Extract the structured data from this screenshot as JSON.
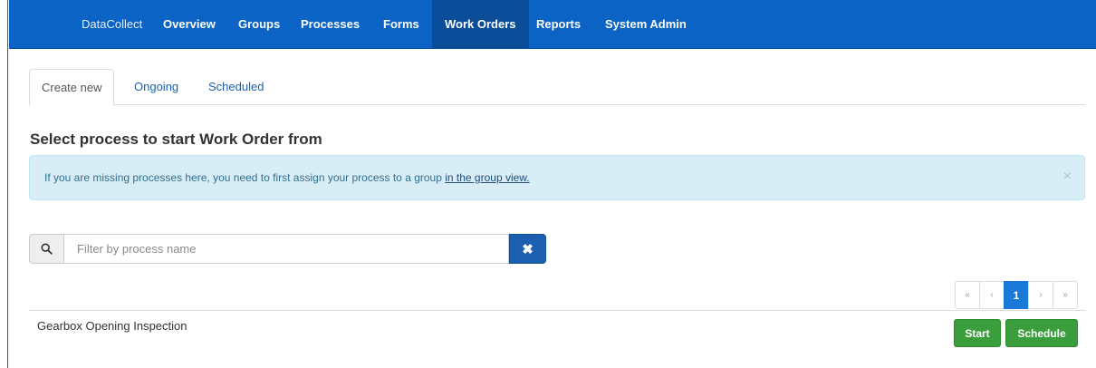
{
  "navbar": {
    "brand": "DataCollect",
    "items": [
      {
        "label": "Overview"
      },
      {
        "label": "Groups"
      },
      {
        "label": "Processes"
      },
      {
        "label": "Forms"
      },
      {
        "label": "Work Orders",
        "active": true
      },
      {
        "label": "Reports"
      },
      {
        "label": "System Admin"
      }
    ],
    "color": "#0b63c6"
  },
  "tabs": [
    {
      "label": "Create new",
      "active": true
    },
    {
      "label": "Ongoing"
    },
    {
      "label": "Scheduled"
    }
  ],
  "page_title": "Select process to start Work Order from",
  "alert": {
    "text": "If you are missing processes here, you need to first assign your process to a group ",
    "link": "in the group view.",
    "close": "×"
  },
  "search": {
    "icon": "search-icon",
    "placeholder": "Filter by process name",
    "value": "",
    "clear_label": "✖"
  },
  "pagination": {
    "first": "«",
    "prev": "‹",
    "current": "1",
    "next": "›",
    "last": "»"
  },
  "processes": [
    {
      "name": "Gearbox Opening Inspection",
      "start_label": "Start",
      "schedule_label": "Schedule"
    }
  ],
  "colors": {
    "primary": "#0b63c6",
    "success": "#3a9e3d",
    "info_bg": "#d9edf7"
  }
}
